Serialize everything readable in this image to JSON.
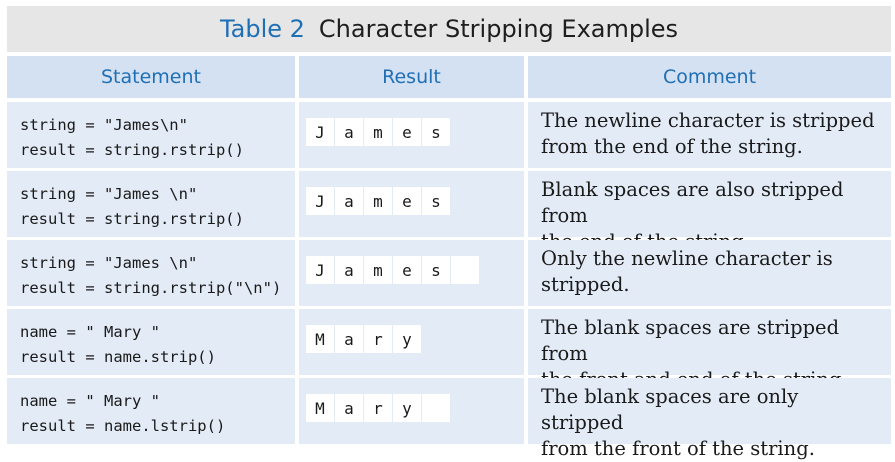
{
  "title": {
    "number": "Table 2",
    "text": "Character Stripping Examples"
  },
  "columns": [
    "Statement",
    "Result",
    "Comment"
  ],
  "rows": [
    {
      "statement": [
        "string = \"James\\n\"",
        "result = string.rstrip()"
      ],
      "result_chars": [
        "J",
        "a",
        "m",
        "e",
        "s"
      ],
      "comment": [
        "The newline character is stripped",
        "from the end of the string."
      ]
    },
    {
      "statement": [
        "string = \"James \\n\"",
        "result = string.rstrip()"
      ],
      "result_chars": [
        "J",
        "a",
        "m",
        "e",
        "s"
      ],
      "comment": [
        "Blank spaces are also stripped from",
        "the end of the string."
      ]
    },
    {
      "statement": [
        "string = \"James \\n\"",
        "result = string.rstrip(\"\\n\")"
      ],
      "result_chars": [
        "J",
        "a",
        "m",
        "e",
        "s",
        " "
      ],
      "comment": [
        "Only the newline character is",
        "stripped."
      ]
    },
    {
      "statement": [
        "name = \" Mary \"",
        "result = name.strip()"
      ],
      "result_chars": [
        "M",
        "a",
        "r",
        "y"
      ],
      "comment": [
        "The blank spaces are stripped from",
        "the front and end of the string."
      ]
    },
    {
      "statement": [
        "name = \" Mary \"",
        "result = name.lstrip()"
      ],
      "result_chars": [
        "M",
        "a",
        "r",
        "y",
        " "
      ],
      "comment": [
        "The blank spaces are only stripped",
        "from the front of the string."
      ]
    }
  ]
}
